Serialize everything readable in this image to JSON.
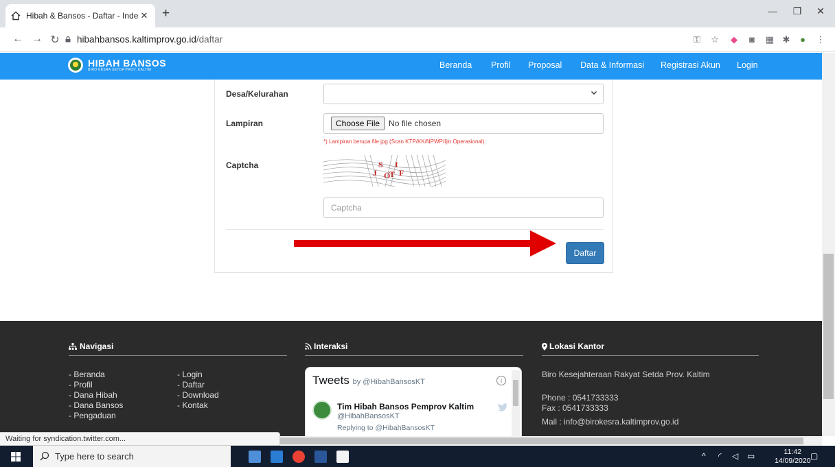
{
  "browser": {
    "tab_title": "Hibah & Bansos - Daftar - Index",
    "url_host": "hibahbansos.kaltimprov.go.id",
    "url_path": "/daftar"
  },
  "site": {
    "logo_title": "HIBAH BANSOS",
    "logo_sub": "BIRO KESRA SETDA PROV. KALTIM",
    "menu": [
      "Beranda",
      "Profil",
      "Proposal",
      "Data & Informasi",
      "Registrasi Akun",
      "Login"
    ]
  },
  "form": {
    "desa_label": "Desa/Kelurahan",
    "desa_value": "",
    "lampiran_label": "Lampiran",
    "choose_file": "Choose File",
    "no_file": "No file chosen",
    "lampiran_hint": "*) Lampiran berupa file jpg (Scan KTP/KK/NPWP/Ijin Operasional)",
    "captcha_label": "Captcha",
    "captcha_chars": [
      "J",
      "S",
      "O",
      "T",
      "I",
      "F"
    ],
    "captcha_placeholder": "Captcha",
    "submit_label": "Daftar"
  },
  "footer": {
    "nav_heading": "Navigasi",
    "nav_col1": [
      "- Beranda",
      "- Profil",
      "- Dana Hibah",
      "- Dana Bansos",
      "- Pengaduan"
    ],
    "nav_col2": [
      "- Login",
      "- Daftar",
      "- Download",
      "- Kontak"
    ],
    "interaksi_heading": "Interaksi",
    "lokasi_heading": "Lokasi Kantor",
    "office_name": "Biro Kesejahteraan Rakyat Setda Prov. Kaltim",
    "phone": "Phone : 0541733333",
    "fax": "Fax : 0541733333",
    "mail": "Mail : info@birokesra.kaltimprov.go.id"
  },
  "tweets": {
    "title": "Tweets",
    "by": "by @HibahBansosKT",
    "author_name": "Tim Hibah Bansos Pemprov Kaltim",
    "author_handle": "@HibahBansosKT",
    "reply": "Replying to @HibahBansosKT"
  },
  "status_bar": "Waiting for syndication.twitter.com...",
  "taskbar": {
    "search_placeholder": "Type here to search",
    "time": "11:42",
    "date": "14/09/2020"
  },
  "colors": {
    "nav_bg": "#2196f3",
    "submit_bg": "#337ab7",
    "arrow": "#e00000",
    "hint": "#e53935",
    "footer_bg": "#2b2b2b"
  }
}
